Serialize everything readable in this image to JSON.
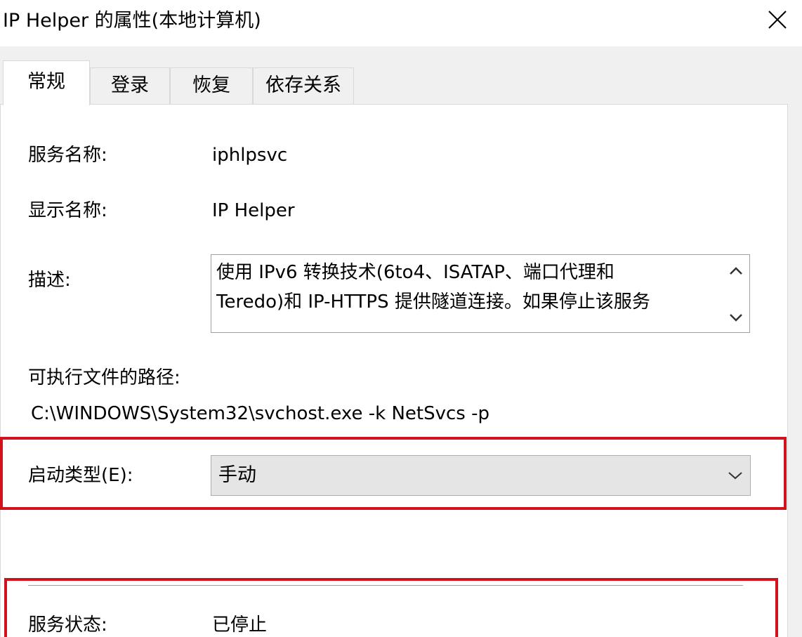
{
  "window": {
    "title": "IP Helper 的属性(本地计算机)",
    "close_icon": "close-icon"
  },
  "tabs": [
    {
      "label": "常规",
      "active": true
    },
    {
      "label": "登录",
      "active": false
    },
    {
      "label": "恢复",
      "active": false
    },
    {
      "label": "依存关系",
      "active": false
    }
  ],
  "general": {
    "service_name_label": "服务名称:",
    "service_name_value": "iphlpsvc",
    "display_name_label": "显示名称:",
    "display_name_value": "IP Helper",
    "description_label": "描述:",
    "description_lines": [
      "使用 IPv6 转换技术(6to4、ISATAP、端口代理和",
      "Teredo)和 IP-HTTPS 提供隧道连接。如果停止该服务"
    ],
    "exe_path_label": "可执行文件的路径:",
    "exe_path_value": "C:\\WINDOWS\\System32\\svchost.exe -k NetSvcs -p",
    "startup_type_label": "启动类型(E):",
    "startup_type_value": "手动",
    "service_status_label": "服务状态:",
    "service_status_value": "已停止"
  },
  "colors": {
    "highlight": "#d2121b",
    "dialog_bg": "#f0f0f0",
    "page_bg": "#ffffff",
    "combo_bg": "#e5e5e5"
  }
}
